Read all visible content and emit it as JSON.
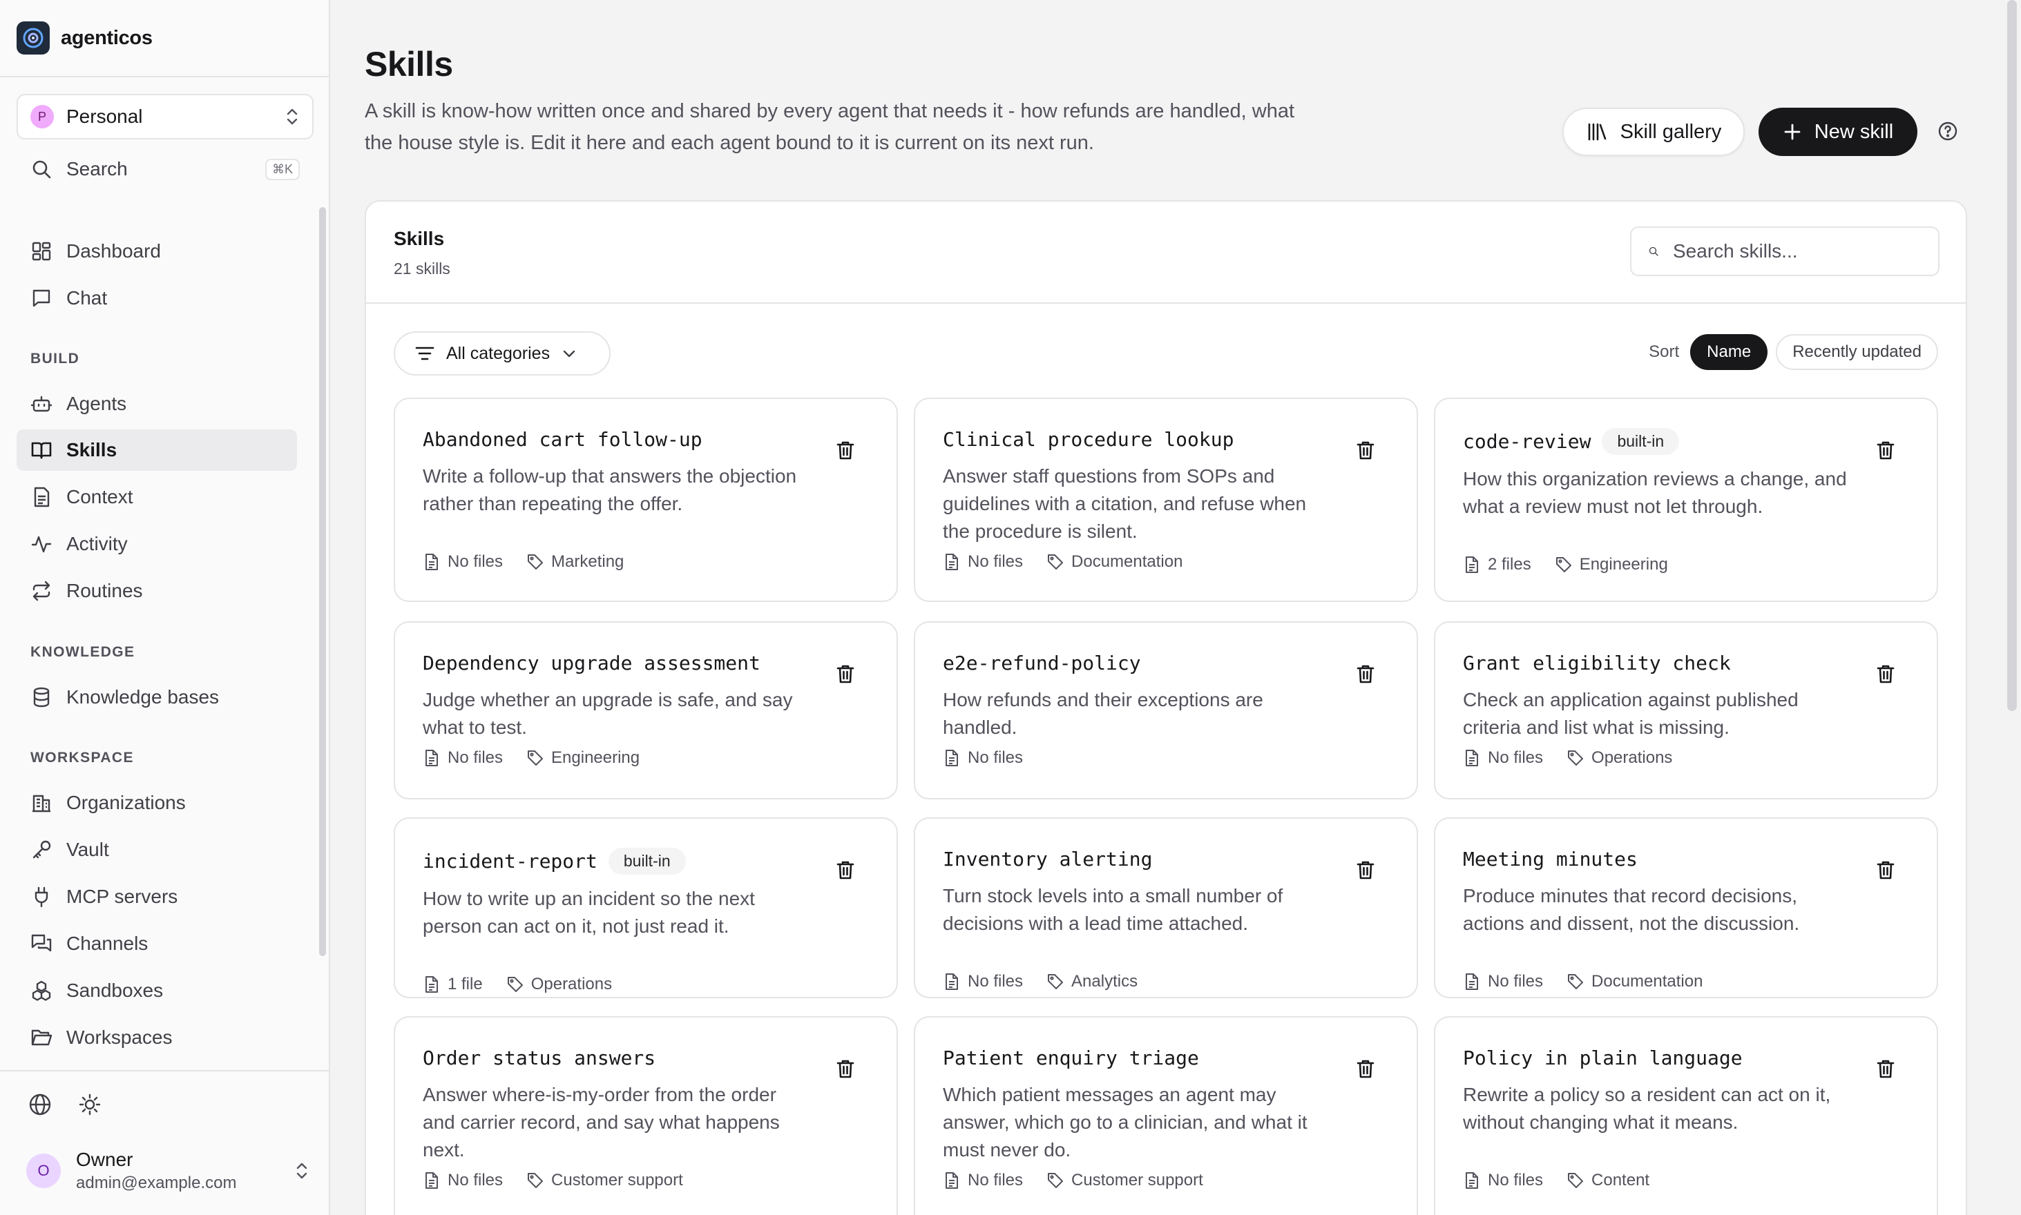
{
  "app": {
    "name": "agenticos"
  },
  "sidebar": {
    "org": {
      "initial": "P",
      "name": "Personal"
    },
    "search": {
      "label": "Search",
      "shortcut": "⌘K"
    },
    "items_top": [
      {
        "label": "Dashboard",
        "icon": "dashboard-icon"
      },
      {
        "label": "Chat",
        "icon": "chat-icon"
      }
    ],
    "sections": {
      "build": "BUILD",
      "knowledge": "KNOWLEDGE",
      "workspace": "WORKSPACE"
    },
    "build_items": [
      {
        "label": "Agents",
        "icon": "robot-icon"
      },
      {
        "label": "Skills",
        "icon": "book-icon",
        "active": true
      },
      {
        "label": "Context",
        "icon": "file-icon"
      },
      {
        "label": "Activity",
        "icon": "activity-icon"
      },
      {
        "label": "Routines",
        "icon": "repeat-icon"
      }
    ],
    "knowledge_items": [
      {
        "label": "Knowledge bases",
        "icon": "database-icon"
      }
    ],
    "workspace_items": [
      {
        "label": "Organizations",
        "icon": "building-icon"
      },
      {
        "label": "Vault",
        "icon": "key-icon"
      },
      {
        "label": "MCP servers",
        "icon": "plug-icon"
      },
      {
        "label": "Channels",
        "icon": "channels-icon"
      },
      {
        "label": "Sandboxes",
        "icon": "boxes-icon"
      },
      {
        "label": "Workspaces",
        "icon": "folder-icon"
      }
    ],
    "user": {
      "initial": "O",
      "name": "Owner",
      "email": "admin@example.com"
    }
  },
  "header": {
    "title": "Skills",
    "description": "A skill is know-how written once and shared by every agent that needs it - how refunds are handled, what the house style is. Edit it here and each agent bound to it is current on its next run.",
    "gallery_label": "Skill gallery",
    "new_label": "New skill"
  },
  "panel": {
    "title": "Skills",
    "count": "21 skills",
    "search_placeholder": "Search skills...",
    "filter_label": "All categories",
    "sort_label": "Sort",
    "sort_options": [
      "Name",
      "Recently updated"
    ],
    "sort_active": "Name"
  },
  "skills": [
    {
      "name": "Abandoned cart follow-up",
      "badge": "",
      "desc": "Write a follow-up that answers the objection rather than repeating the offer.",
      "files": "No files",
      "category": "Marketing"
    },
    {
      "name": "Clinical procedure lookup",
      "badge": "",
      "desc": "Answer staff questions from SOPs and guidelines with a citation, and refuse when the procedure is silent.",
      "files": "No files",
      "category": "Documentation"
    },
    {
      "name": "code-review",
      "badge": "built-in",
      "desc": "How this organization reviews a change, and what a review must not let through.",
      "files": "2 files",
      "category": "Engineering"
    },
    {
      "name": "Dependency upgrade assessment",
      "badge": "",
      "desc": "Judge whether an upgrade is safe, and say what to test.",
      "files": "No files",
      "category": "Engineering"
    },
    {
      "name": "e2e-refund-policy",
      "badge": "",
      "desc": "How refunds and their exceptions are handled.",
      "files": "No files",
      "category": ""
    },
    {
      "name": "Grant eligibility check",
      "badge": "",
      "desc": "Check an application against published criteria and list what is missing.",
      "files": "No files",
      "category": "Operations"
    },
    {
      "name": "incident-report",
      "badge": "built-in",
      "desc": "How to write up an incident so the next person can act on it, not just read it.",
      "files": "1 file",
      "category": "Operations"
    },
    {
      "name": "Inventory alerting",
      "badge": "",
      "desc": "Turn stock levels into a small number of decisions with a lead time attached.",
      "files": "No files",
      "category": "Analytics"
    },
    {
      "name": "Meeting minutes",
      "badge": "",
      "desc": "Produce minutes that record decisions, actions and dissent, not the discussion.",
      "files": "No files",
      "category": "Documentation"
    },
    {
      "name": "Order status answers",
      "badge": "",
      "desc": "Answer where-is-my-order from the order and carrier record, and say what happens next.",
      "files": "No files",
      "category": "Customer support"
    },
    {
      "name": "Patient enquiry triage",
      "badge": "",
      "desc": "Which patient messages an agent may answer, which go to a clinician, and what it must never do.",
      "files": "No files",
      "category": "Customer support"
    },
    {
      "name": "Policy in plain language",
      "badge": "",
      "desc": "Rewrite a policy so a resident can act on it, without changing what it means.",
      "files": "No files",
      "category": "Content"
    }
  ]
}
